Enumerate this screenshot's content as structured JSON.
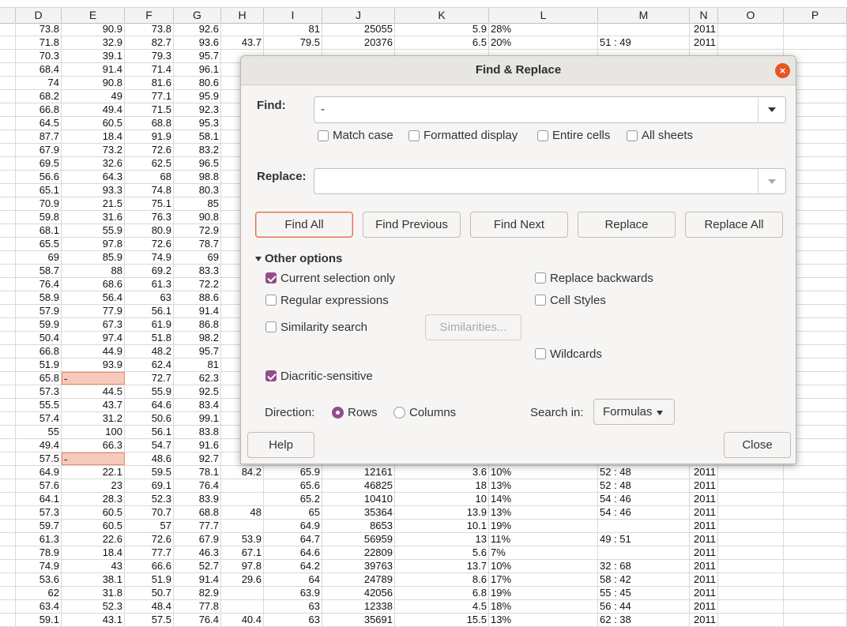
{
  "sheet": {
    "columns": [
      "D",
      "E",
      "F",
      "G",
      "H",
      "I",
      "J",
      "K",
      "L",
      "M",
      "N",
      "O",
      "P"
    ],
    "rows": [
      [
        "73.8",
        "90.9",
        "73.8",
        "92.6",
        "",
        "81",
        "25055",
        "5.9",
        "28%",
        "",
        "2011"
      ],
      [
        "71.8",
        "32.9",
        "82.7",
        "93.6",
        "43.7",
        "79.5",
        "20376",
        "6.5",
        "20%",
        "51 : 49",
        "2011"
      ],
      [
        "70.3",
        "39.1",
        "79.3",
        "95.7",
        "",
        "",
        "",
        "",
        "",
        "",
        ""
      ],
      [
        "68.4",
        "91.4",
        "71.4",
        "96.1",
        "",
        "",
        "",
        "",
        "",
        "",
        ""
      ],
      [
        "74",
        "90.8",
        "81.6",
        "80.6",
        "",
        "",
        "",
        "",
        "",
        "",
        ""
      ],
      [
        "68.2",
        "49",
        "77.1",
        "95.9",
        "",
        "",
        "",
        "",
        "",
        "",
        ""
      ],
      [
        "66.8",
        "49.4",
        "71.5",
        "92.3",
        "",
        "",
        "",
        "",
        "",
        "",
        ""
      ],
      [
        "64.5",
        "60.5",
        "68.8",
        "95.3",
        "",
        "",
        "",
        "",
        "",
        "",
        ""
      ],
      [
        "87.7",
        "18.4",
        "91.9",
        "58.1",
        "",
        "",
        "",
        "",
        "",
        "",
        ""
      ],
      [
        "67.9",
        "73.2",
        "72.6",
        "83.2",
        "",
        "",
        "",
        "",
        "",
        "",
        ""
      ],
      [
        "69.5",
        "32.6",
        "62.5",
        "96.5",
        "",
        "",
        "",
        "",
        "",
        "",
        ""
      ],
      [
        "56.6",
        "64.3",
        "68",
        "98.8",
        "",
        "",
        "",
        "",
        "",
        "",
        ""
      ],
      [
        "65.1",
        "93.3",
        "74.8",
        "80.3",
        "",
        "",
        "",
        "",
        "",
        "",
        ""
      ],
      [
        "70.9",
        "21.5",
        "75.1",
        "85",
        "",
        "",
        "",
        "",
        "",
        "",
        ""
      ],
      [
        "59.8",
        "31.6",
        "76.3",
        "90.8",
        "",
        "",
        "",
        "",
        "",
        "",
        ""
      ],
      [
        "68.1",
        "55.9",
        "80.9",
        "72.9",
        "",
        "",
        "",
        "",
        "",
        "",
        ""
      ],
      [
        "65.5",
        "97.8",
        "72.6",
        "78.7",
        "",
        "",
        "",
        "",
        "",
        "",
        ""
      ],
      [
        "69",
        "85.9",
        "74.9",
        "69",
        "",
        "",
        "",
        "",
        "",
        "",
        ""
      ],
      [
        "58.7",
        "88",
        "69.2",
        "83.3",
        "",
        "",
        "",
        "",
        "",
        "",
        ""
      ],
      [
        "76.4",
        "68.6",
        "61.3",
        "72.2",
        "",
        "",
        "",
        "",
        "",
        "",
        ""
      ],
      [
        "58.9",
        "56.4",
        "63",
        "88.6",
        "",
        "",
        "",
        "",
        "",
        "",
        ""
      ],
      [
        "57.9",
        "77.9",
        "56.1",
        "91.4",
        "",
        "",
        "",
        "",
        "",
        "",
        ""
      ],
      [
        "59.9",
        "67.3",
        "61.9",
        "86.8",
        "",
        "",
        "",
        "",
        "",
        "",
        ""
      ],
      [
        "50.4",
        "97.4",
        "51.8",
        "98.2",
        "",
        "",
        "",
        "",
        "",
        "",
        ""
      ],
      [
        "66.8",
        "44.9",
        "48.2",
        "95.7",
        "",
        "",
        "",
        "",
        "",
        "",
        ""
      ],
      [
        "51.9",
        "93.9",
        "62.4",
        "81",
        "",
        "",
        "",
        "",
        "",
        "",
        ""
      ],
      [
        "65.8",
        "-",
        "72.7",
        "62.3",
        "",
        "",
        "",
        "",
        "",
        "",
        ""
      ],
      [
        "57.3",
        "44.5",
        "55.9",
        "92.5",
        "",
        "",
        "",
        "",
        "",
        "",
        ""
      ],
      [
        "55.5",
        "43.7",
        "64.6",
        "83.4",
        "",
        "",
        "",
        "",
        "",
        "",
        ""
      ],
      [
        "57.4",
        "31.2",
        "50.6",
        "99.1",
        "",
        "",
        "",
        "",
        "",
        "",
        ""
      ],
      [
        "55",
        "100",
        "56.1",
        "83.8",
        "",
        "",
        "",
        "",
        "",
        "",
        ""
      ],
      [
        "49.4",
        "66.3",
        "54.7",
        "91.6",
        "",
        "",
        "",
        "",
        "",
        "",
        ""
      ],
      [
        "57.5",
        "-",
        "48.6",
        "92.7",
        "",
        "",
        "",
        "",
        "",
        "",
        ""
      ],
      [
        "64.9",
        "22.1",
        "59.5",
        "78.1",
        "84.2",
        "65.9",
        "12161",
        "3.6",
        "10%",
        "52 : 48",
        "2011"
      ],
      [
        "57.6",
        "23",
        "69.1",
        "76.4",
        "",
        "65.6",
        "46825",
        "18",
        "13%",
        "52 : 48",
        "2011"
      ],
      [
        "64.1",
        "28.3",
        "52.3",
        "83.9",
        "",
        "65.2",
        "10410",
        "10",
        "14%",
        "54 : 46",
        "2011"
      ],
      [
        "57.3",
        "60.5",
        "70.7",
        "68.8",
        "48",
        "65",
        "35364",
        "13.9",
        "13%",
        "54 : 46",
        "2011"
      ],
      [
        "59.7",
        "60.5",
        "57",
        "77.7",
        "",
        "64.9",
        "8653",
        "10.1",
        "19%",
        "",
        "2011"
      ],
      [
        "61.3",
        "22.6",
        "72.6",
        "67.9",
        "53.9",
        "64.7",
        "56959",
        "13",
        "11%",
        "49 : 51",
        "2011"
      ],
      [
        "78.9",
        "18.4",
        "77.7",
        "46.3",
        "67.1",
        "64.6",
        "22809",
        "5.6",
        "7%",
        "",
        "2011"
      ],
      [
        "74.9",
        "43",
        "66.6",
        "52.7",
        "97.8",
        "64.2",
        "39763",
        "13.7",
        "10%",
        "32 : 68",
        "2011"
      ],
      [
        "53.6",
        "38.1",
        "51.9",
        "91.4",
        "29.6",
        "64",
        "24789",
        "8.6",
        "17%",
        "58 : 42",
        "2011"
      ],
      [
        "62",
        "31.8",
        "50.7",
        "82.9",
        "",
        "63.9",
        "42056",
        "6.8",
        "19%",
        "55 : 45",
        "2011"
      ],
      [
        "63.4",
        "52.3",
        "48.4",
        "77.8",
        "",
        "63",
        "12338",
        "4.5",
        "18%",
        "56 : 44",
        "2011"
      ],
      [
        "59.1",
        "43.1",
        "57.5",
        "76.4",
        "40.4",
        "63",
        "35691",
        "15.5",
        "13%",
        "62 : 38",
        "2011"
      ]
    ]
  },
  "dialog": {
    "title": "Find & Replace",
    "close_x": "×",
    "find_label": "Find:",
    "find_value": "-",
    "replace_label": "Replace:",
    "replace_value": "",
    "find_options": {
      "match_case": "Match case",
      "formatted_display": "Formatted display",
      "entire_cells": "Entire cells",
      "all_sheets": "All sheets"
    },
    "buttons": {
      "find_all": "Find All",
      "find_previous": "Find Previous",
      "find_next": "Find Next",
      "replace": "Replace",
      "replace_all": "Replace All"
    },
    "other_options": "Other options",
    "options": {
      "current_selection_only": "Current selection only",
      "replace_backwards": "Replace backwards",
      "regular_expressions": "Regular expressions",
      "cell_styles": "Cell Styles",
      "similarity_search": "Similarity search",
      "similarities_button": "Similarities...",
      "wildcards": "Wildcards",
      "diacritic_sensitive": "Diacritic-sensitive"
    },
    "direction_label": "Direction:",
    "direction_rows": "Rows",
    "direction_columns": "Columns",
    "search_in_label": "Search in:",
    "search_in_value": "Formulas",
    "help": "Help",
    "close": "Close"
  }
}
